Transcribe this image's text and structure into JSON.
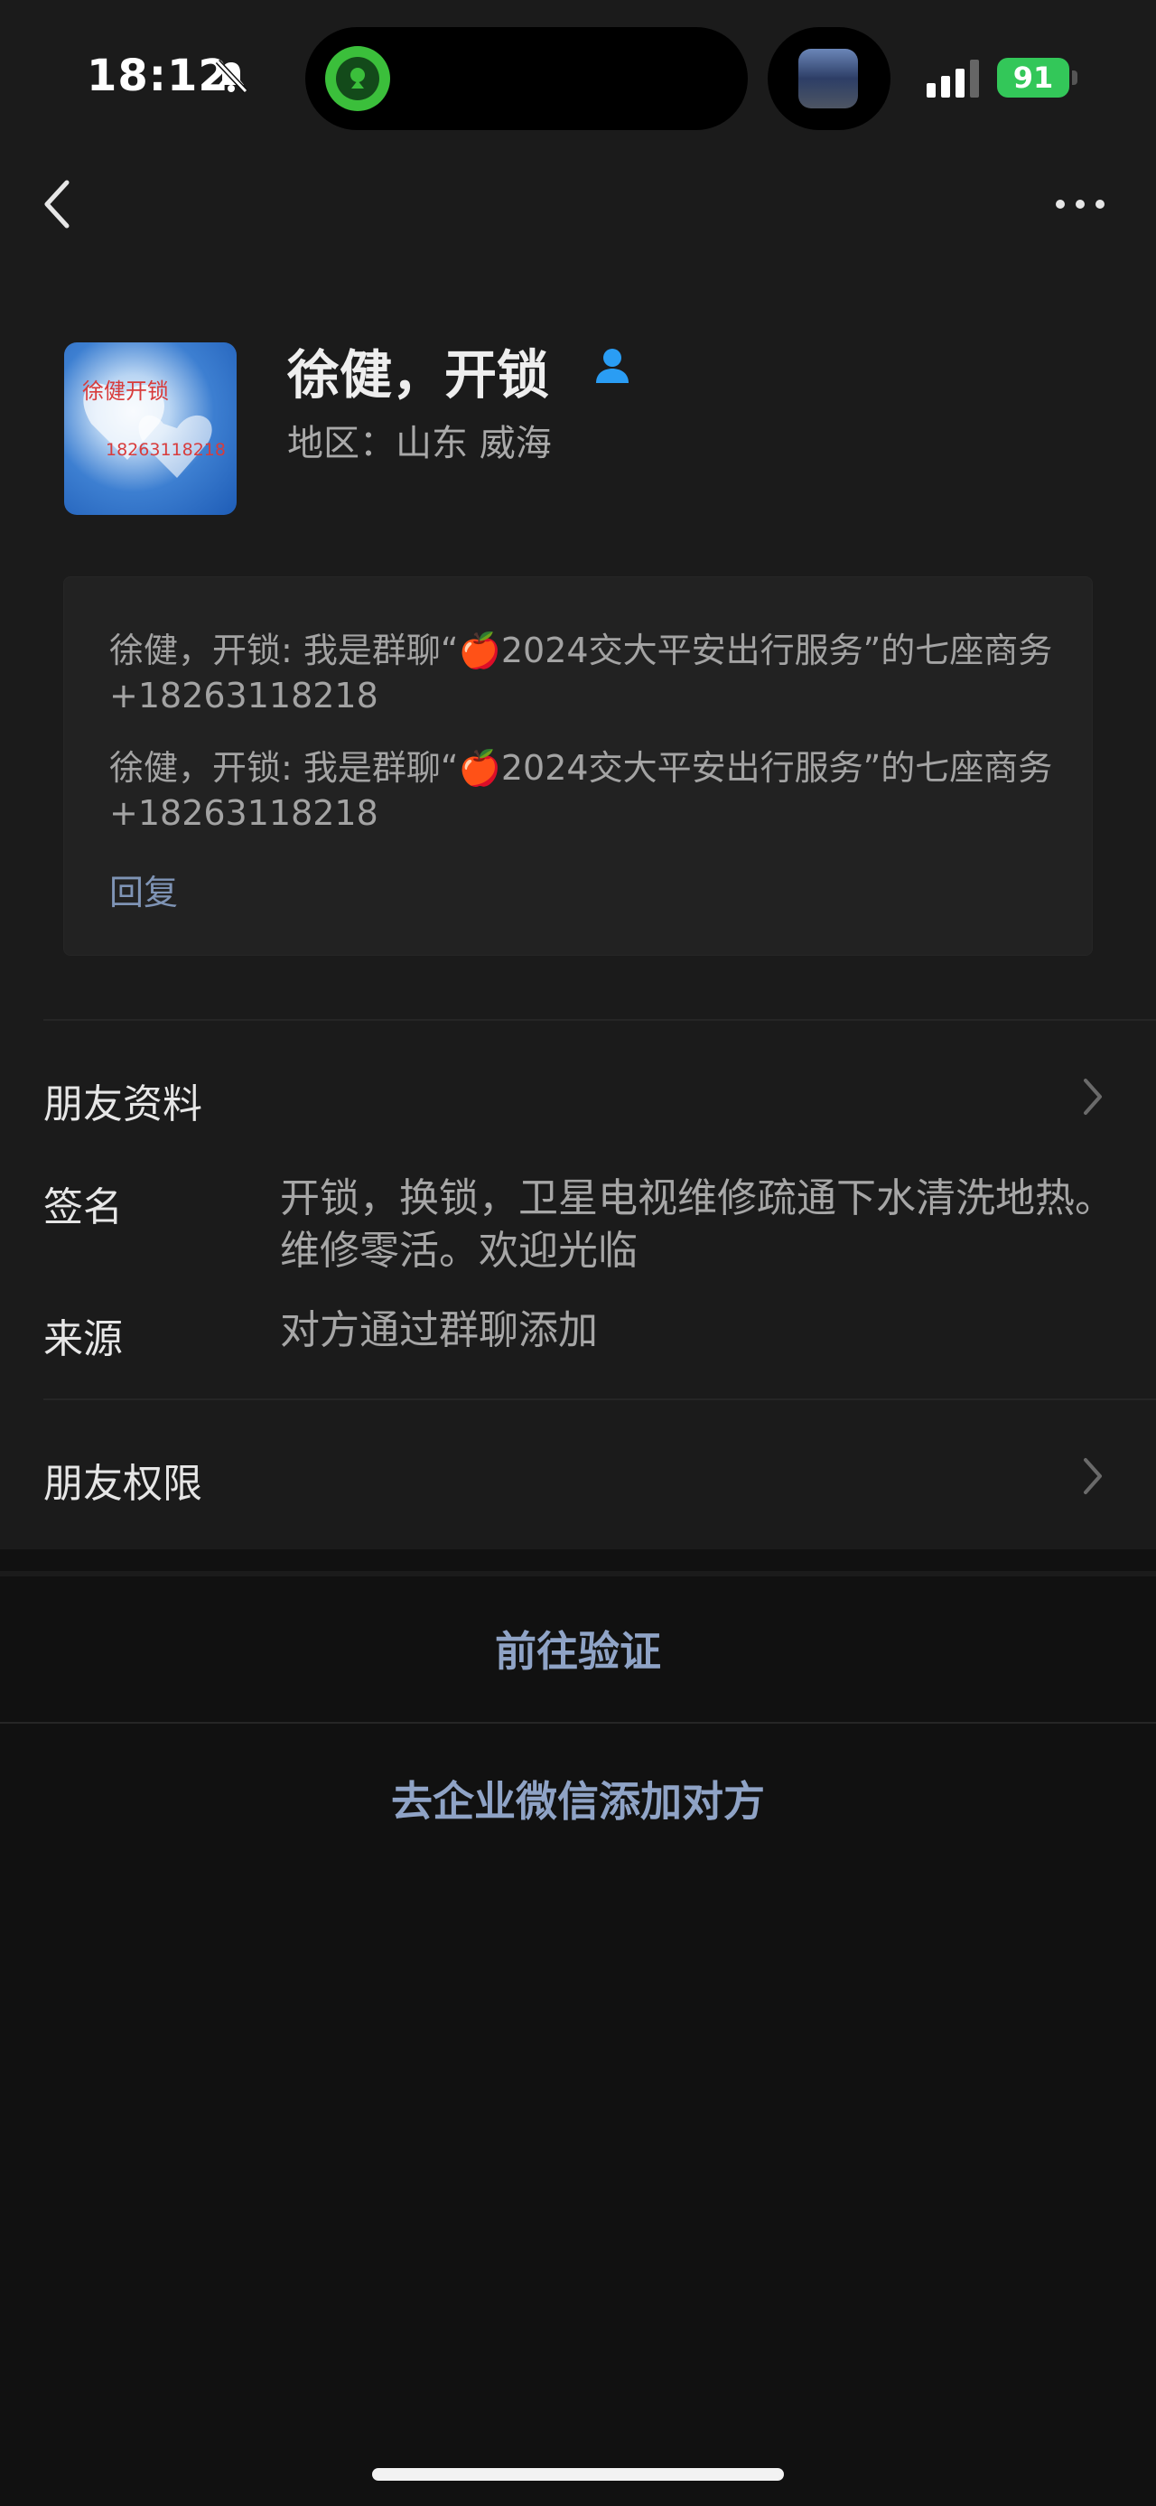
{
  "status_bar": {
    "time": "18:12",
    "battery": "91"
  },
  "profile": {
    "name": "徐健，开锁",
    "region": "地区：山东 威海",
    "avatar_text_line1": "徐健开锁",
    "avatar_text_line2": "18263118218"
  },
  "messages": [
    "徐健，开锁: 我是群聊“🍎2024交大平安出行服务”的七座商务+18263118218",
    "徐健，开锁: 我是群聊“🍎2024交大平安出行服务”的七座商务+18263118218"
  ],
  "reply_label": "回复",
  "friend_profile_label": "朋友资料",
  "signature": {
    "label": "签名",
    "value": "开锁，换锁，卫星电视维修疏通下水清洗地热。维修零活。欢迎光临"
  },
  "source": {
    "label": "来源",
    "value": "对方通过群聊添加"
  },
  "friend_permissions_label": "朋友权限",
  "actions": {
    "verify": "前往验证",
    "wecom_add": "去企业微信添加对方"
  },
  "colors": {
    "background": "#111111",
    "surface": "#1b1b1b",
    "link": "#8fa3c6",
    "battery": "#33c759"
  }
}
